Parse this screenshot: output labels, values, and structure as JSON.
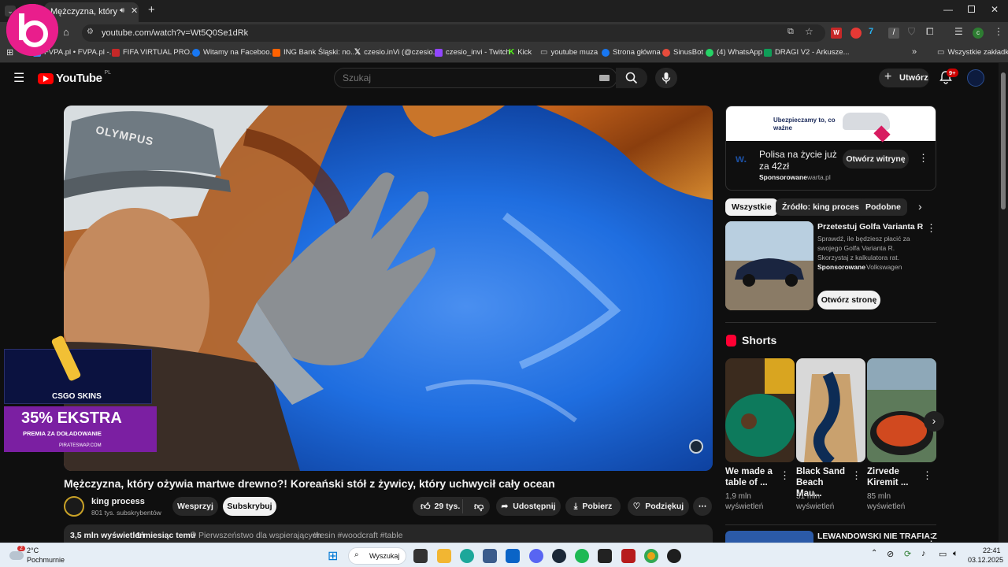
{
  "browser": {
    "tab_title": "Mężczyzna, który ożyw",
    "url": "youtube.com/watch?v=Wt5Q0Se1dRk",
    "bookmarks": [
      {
        "label": "FVPA.pl • FVPA.pl -...",
        "color": "#4285f4"
      },
      {
        "label": "FIFA VIRTUAL PRO...",
        "color": "#c0392b"
      },
      {
        "label": "Witamy na Faceboo...",
        "color": "#1877f2"
      },
      {
        "label": "ING Bank Śląski: no...",
        "color": "#ff6200"
      },
      {
        "label": "czesio.inVi (@czesio...",
        "color": "#000000"
      },
      {
        "label": "czesio_invi - Twitch",
        "color": "#9146ff"
      },
      {
        "label": "Kick",
        "color": "#53fc18"
      },
      {
        "label": "youtube muza",
        "color": "#888888"
      },
      {
        "label": "Strona główna",
        "color": "#1877f2"
      },
      {
        "label": "SinusBot",
        "color": "#e74c3c"
      },
      {
        "label": "(4) WhatsApp",
        "color": "#25d366"
      },
      {
        "label": "DRAGI V2 - Arkusze...",
        "color": "#0f9d58"
      }
    ],
    "all_bookmarks": "Wszystkie zakładki"
  },
  "youtube": {
    "logo": "YouTube",
    "logo_region": "PL",
    "search_placeholder": "Szukaj",
    "create_label": "Utwórz",
    "notifications": "9+"
  },
  "video": {
    "title": "Mężczyzna, który ożywia martwe drewno?! Koreański stół z żywicy, który uchwycił cały ocean",
    "channel": "king process",
    "subscribers": "801 tys. subskrybentów",
    "support_label": "Wesprzyj",
    "subscribe_label": "Subskrybuj",
    "likes": "29 tys.",
    "share_label": "Udostępnij",
    "download_label": "Pobierz",
    "thanks_label": "Podziękuj",
    "views": "3,5 mln wyświetleń",
    "age": "1 miesiąc temu",
    "priority": "Pierwszeństwo dla wspierających",
    "tags": "#resin #woodcraft #table",
    "overlay_brand": "CSGO SKINS",
    "overlay_promo": "35% EKSTRA",
    "overlay_promo_sub": "PREMIA ZA DOŁADOWANIE",
    "overlay_site": "PIRATESWAP.COM",
    "overlay_cap": "OLYMPUS"
  },
  "sidebar": {
    "ad_banner_text": "Ubezpieczamy to, co ważne",
    "ad_title": "Polisa na życie już za 42zł",
    "ad_sponsored": "Sponsorowane",
    "ad_domain": "warta.pl",
    "ad_button": "Otwórz witrynę",
    "chips": [
      "Wszystkie",
      "Źródło: king process",
      "Podobne"
    ],
    "promo_title": "Przetestuj Golfa Varianta R",
    "promo_desc": "Sprawdź, ile będziesz płacić za swojego Golfa Varianta R. Skorzystaj z kalkulatora rat.",
    "promo_sponsored": "Sponsorowane",
    "promo_brand": "Volkswagen",
    "promo_button": "Otwórz stronę",
    "shorts_heading": "Shorts",
    "shorts": [
      {
        "title": "We made a table of ...",
        "views": "1,9 mln wyświetleń"
      },
      {
        "title": "Black Sand Beach Mau...",
        "views": "31 mln wyświetleń"
      },
      {
        "title": "Zirvede Kiremit ...",
        "views": "85 mln wyświetleń"
      }
    ],
    "next_item_title": "LEWANDOWSKI NIE TRAFIA Z"
  },
  "taskbar": {
    "weather_temp": "2°C",
    "weather_desc": "Pochmurnie",
    "weather_badge": "2",
    "search_label": "Wyszukaj",
    "time": "22:41",
    "date": "03.12.2025"
  },
  "colors": {
    "youtube_red": "#ff0000",
    "dark_bg": "#0f0f0f",
    "chip_bg": "#272727",
    "accent_blue": "#3ea6ff",
    "overlay_purple": "#7b1fa2"
  }
}
